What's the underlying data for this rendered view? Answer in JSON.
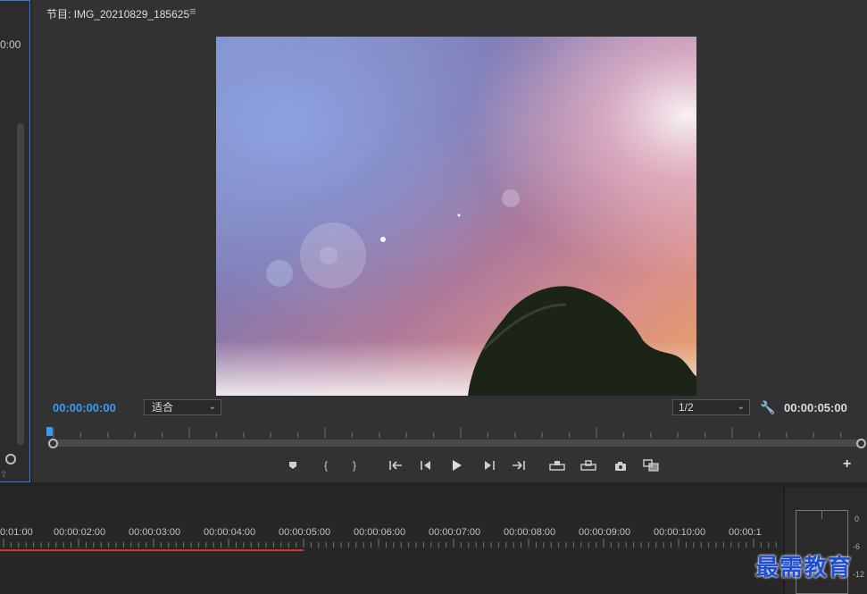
{
  "left_panel": {
    "timecode": "0:00"
  },
  "program": {
    "title": "节目: IMG_20210829_185625",
    "menu_icon": "hamburger-icon",
    "timecode_current": "00:00:00:00",
    "fit_value": "适合",
    "resolution_value": "1/2",
    "timecode_duration": "00:00:05:00",
    "controls": [
      "marker",
      "mark-in",
      "mark-out",
      "go-to-in",
      "step-back",
      "play",
      "step-forward",
      "go-to-out",
      "lift",
      "extract",
      "export-frame",
      "compare"
    ],
    "add_label": "+",
    "colors": {
      "accent": "#3a9bf0"
    }
  },
  "timeline": {
    "ticks": [
      "0:01:00",
      "00:00:02:00",
      "00:00:03:00",
      "00:00:04:00",
      "00:00:05:00",
      "00:00:06:00",
      "00:00:07:00",
      "00:00:08:00",
      "00:00:09:00",
      "00:00:10:00",
      "00:00:1"
    ],
    "work_area_color": "#d9312b"
  },
  "meters": {
    "labels": [
      "0",
      "-6",
      "-12"
    ]
  },
  "watermark": "最需教育"
}
